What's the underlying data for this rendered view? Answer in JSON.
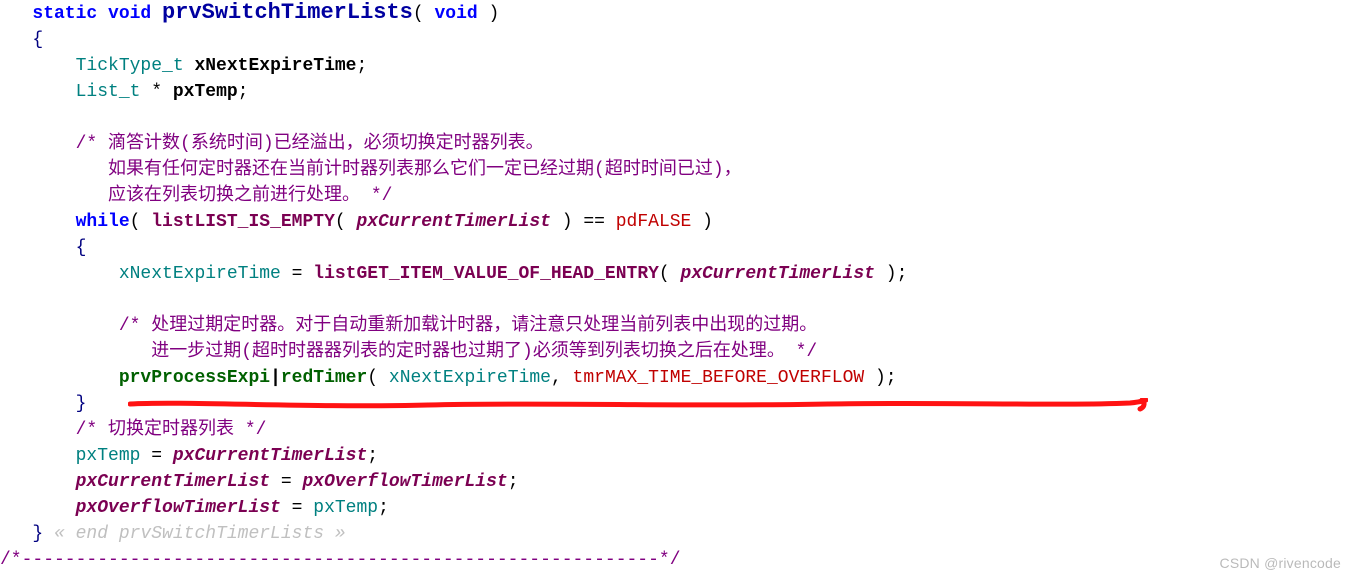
{
  "code": {
    "l1": {
      "kw": "static void",
      "fn": "prvSwitchTimerLists",
      "params": "( ",
      "void": "void",
      "paren_close": " )"
    },
    "l2": {
      "brace": "{"
    },
    "l3": {
      "type": "TickType_t ",
      "var": "xNextExpireTime",
      "semi": ";"
    },
    "l4": {
      "type": "List_t ",
      "star": "* ",
      "var": "pxTemp",
      "semi": ";"
    },
    "l5": {
      "txt": ""
    },
    "l6": {
      "c": "/* 滴答计数(系统时间)已经溢出，必须切换定时器列表。"
    },
    "l7": {
      "c": "   如果有任何定时器还在当前计时器列表那么它们一定已经过期(超时时间已过)，"
    },
    "l8": {
      "c": "   应该在列表切换之前进行处理。 */"
    },
    "l9": {
      "kw": "while",
      "open": "( ",
      "macro": "listLIST_IS_EMPTY",
      "p": "( ",
      "arg": "pxCurrentTimerList",
      "close": " ) == ",
      "val": "pdFALSE",
      "end": " )"
    },
    "l10": {
      "brace": "{"
    },
    "l11": {
      "lhs": "xNextExpireTime",
      "eq": " = ",
      "macro": "listGET_ITEM_VALUE_OF_HEAD_ENTRY",
      "p": "( ",
      "arg": "pxCurrentTimerList",
      "close": " );"
    },
    "l12": {
      "txt": ""
    },
    "l13": {
      "c": "/* 处理过期定时器。对于自动重新加载计时器，请注意只处理当前列表中出现的过期。"
    },
    "l14": {
      "c": "   进一步过期(超时时器器列表的定时器也过期了)必须等到列表切换之后在处理。 */"
    },
    "l15": {
      "fn": "prvProcessExpi",
      "cursor": "|",
      "fn2": "redTimer",
      "p": "( ",
      "arg1": "xNextExpireTime",
      "comma": ", ",
      "arg2": "tmrMAX_TIME_BEFORE_OVERFLOW",
      "close": " );"
    },
    "l16": {
      "brace": "}"
    },
    "l17": {
      "c": "/* 切换定时器列表 */"
    },
    "l18": {
      "lhs": "pxTemp",
      "eq": " = ",
      "rhs": "pxCurrentTimerList",
      "semi": ";"
    },
    "l19": {
      "lhs": "pxCurrentTimerList",
      "eq": " = ",
      "rhs": "pxOverflowTimerList",
      "semi": ";"
    },
    "l20": {
      "lhs": "pxOverflowTimerList",
      "eq": " = ",
      "rhs": "pxTemp",
      "semi": ";"
    },
    "l21": {
      "brace": "}",
      "faded": " « end prvSwitchTimerLists »"
    },
    "l22": {
      "dash": "/*-----------------------------------------------------------*/"
    }
  },
  "watermark": "CSDN @rivencode"
}
